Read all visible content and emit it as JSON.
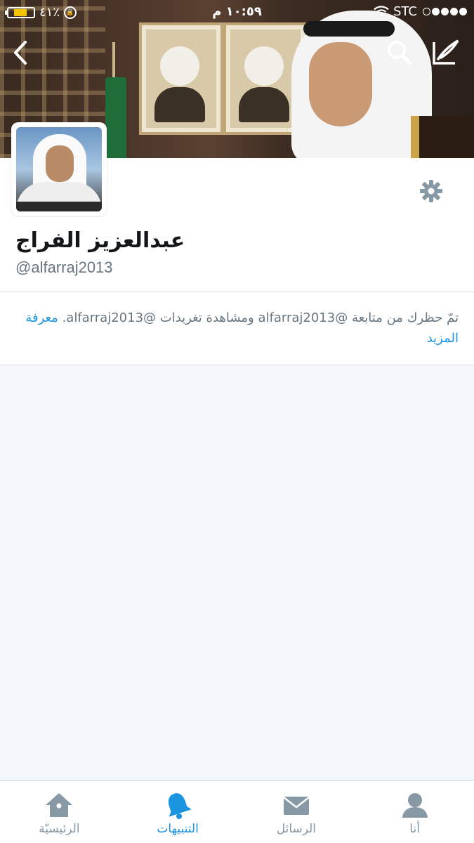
{
  "status_bar": {
    "battery_percent": "٤١٪",
    "time": "١٠:٥٩ م",
    "carrier": "STC",
    "signal_bars": 4
  },
  "header": {
    "icons": [
      "back-icon",
      "search-icon",
      "compose-icon"
    ]
  },
  "profile": {
    "display_name": "عبدالعزيز الفراج",
    "handle": "@alfarraj2013",
    "settings_icon": "gear-icon"
  },
  "blocked_notice": {
    "text": "تمّ حظرك من متابعة @alfarraj2013 ومشاهدة تغريدات @alfarraj2013.",
    "learn_more": "معرفة المزيد"
  },
  "tab_bar": {
    "items": [
      {
        "label": "الرئيسيّة",
        "icon": "home-icon"
      },
      {
        "label": "التنبيهات",
        "icon": "bell-icon",
        "active": true
      },
      {
        "label": "الرسائل",
        "icon": "envelope-icon"
      },
      {
        "label": "أنا",
        "icon": "person-icon"
      }
    ]
  },
  "colors": {
    "accent": "#1b95e0",
    "muted_text": "#66757f",
    "inactive_icon": "#8899a6",
    "background": "#f5f8fa"
  }
}
